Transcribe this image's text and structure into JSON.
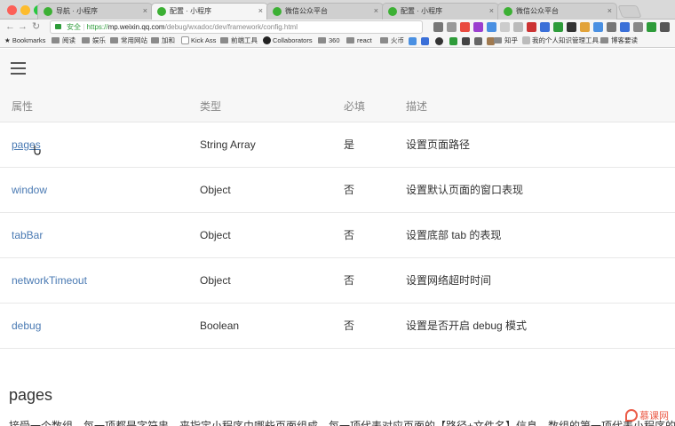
{
  "browser": {
    "tabs": [
      {
        "label": "导航 · 小程序",
        "active": false
      },
      {
        "label": "配置 · 小程序",
        "active": true
      },
      {
        "label": "微信公众平台",
        "active": false
      },
      {
        "label": "配置 · 小程序",
        "active": false
      },
      {
        "label": "微信公众平台",
        "active": false
      }
    ],
    "address": {
      "secure_label": "安全",
      "url_https": "https://",
      "url_host": "mp.weixin.qq.com",
      "url_path": "/debug/wxadoc/dev/framework/config.html"
    },
    "bookmarks": [
      "Bookmarks",
      "阅读",
      "娱乐",
      "常用网站",
      "加和",
      "Kick Ass",
      "前端工具",
      "Collaborators",
      "360",
      "react",
      "火币",
      "知乎",
      "我的个人知识管理工具...",
      "博客要读"
    ]
  },
  "table": {
    "headers": [
      "属性",
      "类型",
      "必填",
      "描述"
    ],
    "rows": [
      {
        "name": "pages",
        "type": "String Array",
        "required": "是",
        "desc": "设置页面路径"
      },
      {
        "name": "window",
        "type": "Object",
        "required": "否",
        "desc": "设置默认页面的窗口表现"
      },
      {
        "name": "tabBar",
        "type": "Object",
        "required": "否",
        "desc": "设置底部 tab 的表现"
      },
      {
        "name": "networkTimeout",
        "type": "Object",
        "required": "否",
        "desc": "设置网络超时时间"
      },
      {
        "name": "debug",
        "type": "Boolean",
        "required": "否",
        "desc": "设置是否开启 debug 模式"
      }
    ]
  },
  "section": {
    "title": "pages",
    "truncated_text": "接受一个数组，每一项都是字符串，来指定小程序由哪些页面组成。每一项代表对应页面的【路径+文件名】信息，数组的第一项代表小程序的初始页面"
  },
  "watermark": {
    "text": "慕课网"
  },
  "colors": {
    "link": "#4a7ab3",
    "tab_favicon": "#3cb034",
    "secure": "#2e9c3a"
  }
}
